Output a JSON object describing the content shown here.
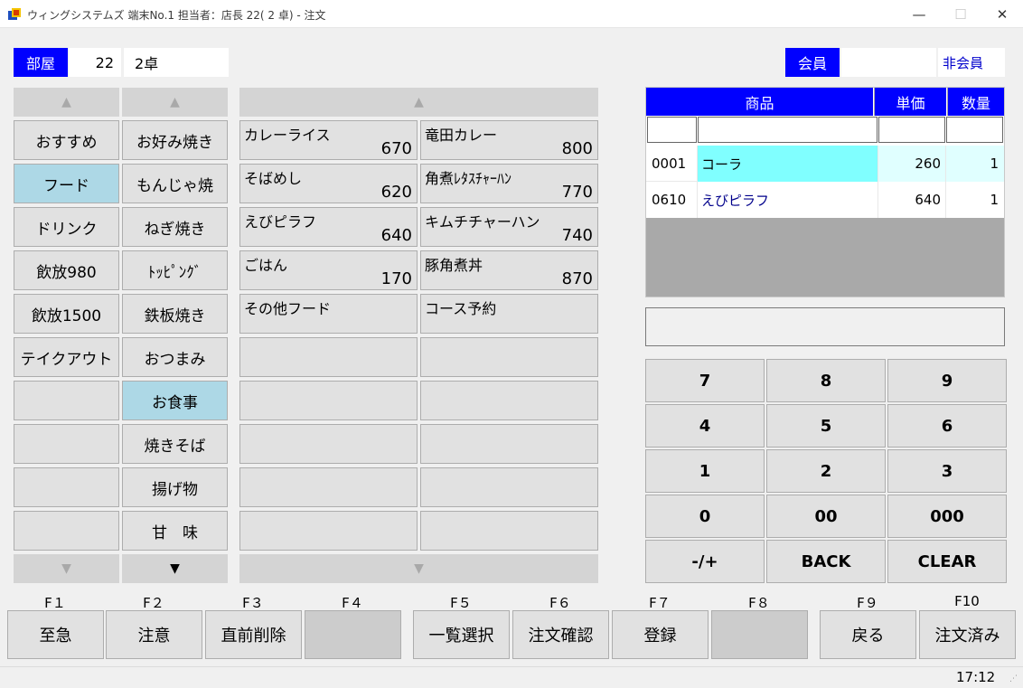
{
  "window": {
    "title": "ウィングシステムズ 端末No.1 担当者：店長 22( 2 卓) - 注文",
    "minimize": "—",
    "maximize": "☐",
    "close": "✕"
  },
  "header": {
    "room_label": "部屋",
    "room_number": "22",
    "table_name": "2卓",
    "member_label": "会員",
    "member_id": "",
    "member_status": "非会員"
  },
  "categories": {
    "col1": [
      "おすすめ",
      "フード",
      "ドリンク",
      "飲放980",
      "飲放1500",
      "テイクアウト",
      "",
      "",
      "",
      ""
    ],
    "col2": [
      "お好み焼き",
      "もんじゃ焼",
      "ねぎ焼き",
      "ﾄｯﾋﾟﾝｸﾞ",
      "鉄板焼き",
      "おつまみ",
      "お食事",
      "焼きそば",
      "揚げ物",
      "甘　味"
    ],
    "selected_col1": "フード",
    "selected_col2": "お食事",
    "up_arrow": "▲",
    "down_arrow": "▼"
  },
  "menu_items": [
    {
      "name": "カレーライス",
      "price": "670"
    },
    {
      "name": "竜田カレー",
      "price": "800"
    },
    {
      "name": "そばめし",
      "price": "620"
    },
    {
      "name": "角煮ﾚﾀｽﾁｬｰﾊﾝ",
      "price": "770"
    },
    {
      "name": "えびピラフ",
      "price": "640"
    },
    {
      "name": "キムチチャーハン",
      "price": "740"
    },
    {
      "name": "ごはん",
      "price": "170"
    },
    {
      "name": "豚角煮丼",
      "price": "870"
    },
    {
      "name": "その他フード",
      "price": ""
    },
    {
      "name": "コース予約",
      "price": ""
    },
    {
      "name": "",
      "price": ""
    },
    {
      "name": "",
      "price": ""
    },
    {
      "name": "",
      "price": ""
    },
    {
      "name": "",
      "price": ""
    },
    {
      "name": "",
      "price": ""
    },
    {
      "name": "",
      "price": ""
    },
    {
      "name": "",
      "price": ""
    },
    {
      "name": "",
      "price": ""
    },
    {
      "name": "",
      "price": ""
    },
    {
      "name": "",
      "price": ""
    }
  ],
  "order": {
    "columns": [
      "商品",
      "単価",
      "数量"
    ],
    "rows": [
      {
        "code": "0001",
        "name": "コーラ",
        "price": "260",
        "qty": "1"
      },
      {
        "code": "0610",
        "name": "えびピラフ",
        "price": "640",
        "qty": "1"
      }
    ],
    "input_value": ""
  },
  "keypad": [
    "7",
    "8",
    "9",
    "4",
    "5",
    "6",
    "1",
    "2",
    "3",
    "0",
    "00",
    "000",
    "-/+",
    "BACK",
    "CLEAR"
  ],
  "fkeys": [
    {
      "key": "F１",
      "label": "至急"
    },
    {
      "key": "F２",
      "label": "注意"
    },
    {
      "key": "F３",
      "label": "直前削除"
    },
    {
      "key": "F４",
      "label": ""
    },
    {
      "key": "F５",
      "label": "一覧選択"
    },
    {
      "key": "F６",
      "label": "注文確認"
    },
    {
      "key": "F７",
      "label": "登録"
    },
    {
      "key": "F８",
      "label": ""
    },
    {
      "key": "F９",
      "label": "戻る"
    },
    {
      "key": "F10",
      "label": "注文済み"
    }
  ],
  "status": {
    "time": "17:12"
  },
  "colors": {
    "header_blue": "#0000ff",
    "selected": "#add8e6",
    "highlight_cyan": "#80ffff",
    "row_tint": "#e0ffff",
    "item_blue": "#00008b"
  }
}
